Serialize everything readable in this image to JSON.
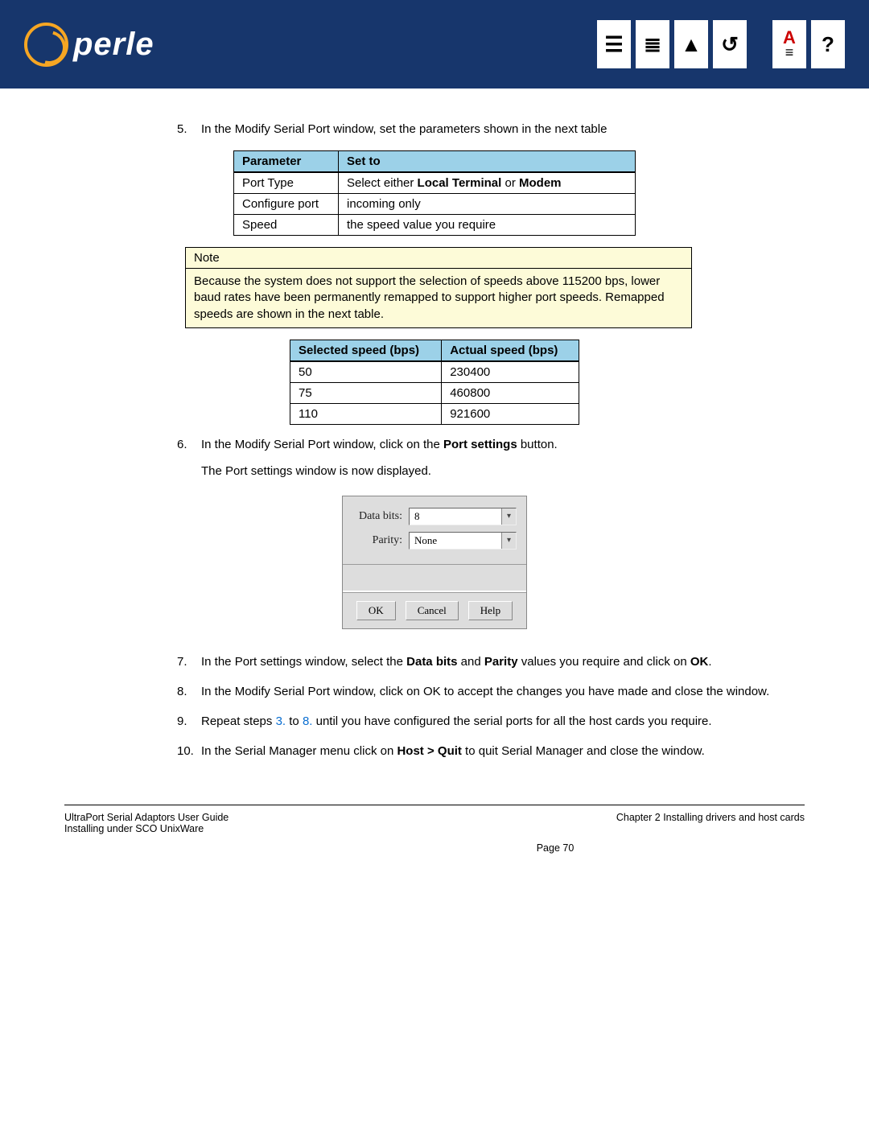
{
  "logo_text": "perle",
  "steps": {
    "s5": {
      "num": "5.",
      "text": "In the Modify Serial Port window, set the parameters shown in the next table"
    },
    "s6": {
      "num": "6.",
      "line1_prefix": "In the Modify Serial Port window, click on the ",
      "line1_bold": "Port settings",
      "line1_suffix": " button.",
      "line2": "The Port settings window is now displayed."
    },
    "s7": {
      "num": "7.",
      "prefix": "In the Port settings window, select the ",
      "b1": "Data bits",
      "mid": " and ",
      "b2": "Parity",
      "suffix1": " values you require and click on ",
      "b3": "OK",
      "suffix2": "."
    },
    "s8": {
      "num": "8.",
      "text": "In the Modify Serial Port window, click on OK to accept the changes you have made and close the window."
    },
    "s9": {
      "num": "9.",
      "prefix": "Repeat steps ",
      "l1": "3.",
      "mid": " to ",
      "l2": "8.",
      "suffix": " until you have configured the serial ports for all the host cards  you require."
    },
    "s10": {
      "num": "10.",
      "prefix": "In the Serial Manager menu click on ",
      "bold": "Host > Quit",
      "suffix": " to quit Serial Manager and close the window."
    }
  },
  "param_table": {
    "h1": "Parameter",
    "h2": "Set to",
    "rows": [
      {
        "p": "Port Type",
        "v_prefix": "Select either ",
        "v_b1": "Local Terminal",
        "v_mid": " or ",
        "v_b2": "Modem"
      },
      {
        "p": "Configure port",
        "v": "incoming only"
      },
      {
        "p": "Speed",
        "v": "the speed value you require"
      }
    ]
  },
  "note": {
    "title": "Note",
    "body": "Because the system does not support the selection of speeds above 115200 bps, lower baud rates have been permanently remapped to support higher port speeds. Remapped speeds are shown in the next table."
  },
  "speed_table": {
    "h1": "Selected speed (bps)",
    "h2": "Actual speed (bps)",
    "rows": [
      {
        "a": "50",
        "b": "230400"
      },
      {
        "a": "75",
        "b": "460800"
      },
      {
        "a": "110",
        "b": "921600"
      }
    ]
  },
  "dialog": {
    "databits_label": "Data bits:",
    "databits_value": "8",
    "parity_label": "Parity:",
    "parity_value": "None",
    "ok": "OK",
    "cancel": "Cancel",
    "help": "Help"
  },
  "footer": {
    "left1": "UltraPort Serial Adaptors User Guide",
    "left2": "Installing under SCO UnixWare",
    "right": "Chapter 2 Installing drivers and host cards",
    "page": "Page 70"
  }
}
